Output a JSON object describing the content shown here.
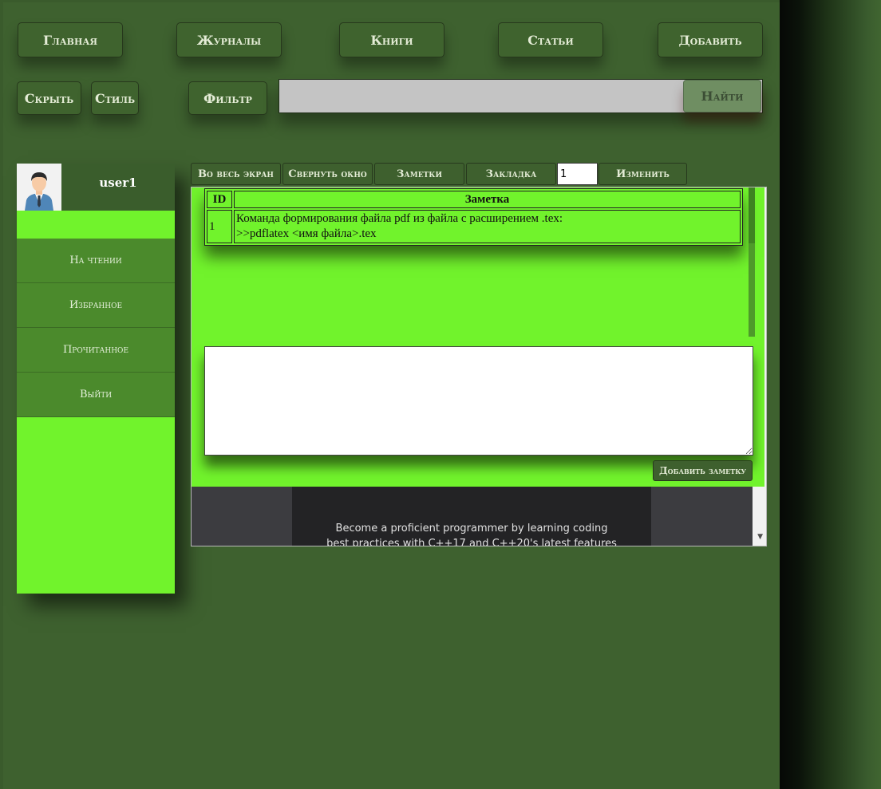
{
  "nav": {
    "home": "Главная",
    "journals": "Журналы",
    "books": "Книги",
    "articles": "Статьи",
    "add": "Добавить"
  },
  "controls": {
    "hide": "Скрыть",
    "style": "Стиль",
    "filter": "Фильтр",
    "search_value": "",
    "search_button": "Найти"
  },
  "user": {
    "name": "user1",
    "avatar_icon": "user-avatar-icon"
  },
  "sidebar": {
    "items": [
      {
        "label": "На чтении"
      },
      {
        "label": "Избранное"
      },
      {
        "label": "Прочитанное"
      },
      {
        "label": "Выйти"
      }
    ]
  },
  "toolbar": {
    "fullscreen": "Во весь экран",
    "minimize": "Свернуть окно",
    "notes": "Заметки",
    "bookmark": "Закладка",
    "page_value": "1",
    "change": "Изменить"
  },
  "notes": {
    "headers": {
      "id": "ID",
      "note": "Заметка"
    },
    "rows": [
      {
        "id": "1",
        "line1": "Команда формирования файла pdf из файла с расширением .tex:",
        "line2": ">>pdflatex <имя файла>.tex"
      }
    ],
    "new_note_value": "",
    "add_button": "Добавить заметку"
  },
  "document": {
    "line1": "Become a proficient programmer by learning coding",
    "line2": "best practices with C++17 and C++20's latest features"
  },
  "colors": {
    "background": "#3e612f",
    "button": "#3f632e",
    "accent_green": "#71f32c",
    "menu_item": "#4b8a2c"
  }
}
